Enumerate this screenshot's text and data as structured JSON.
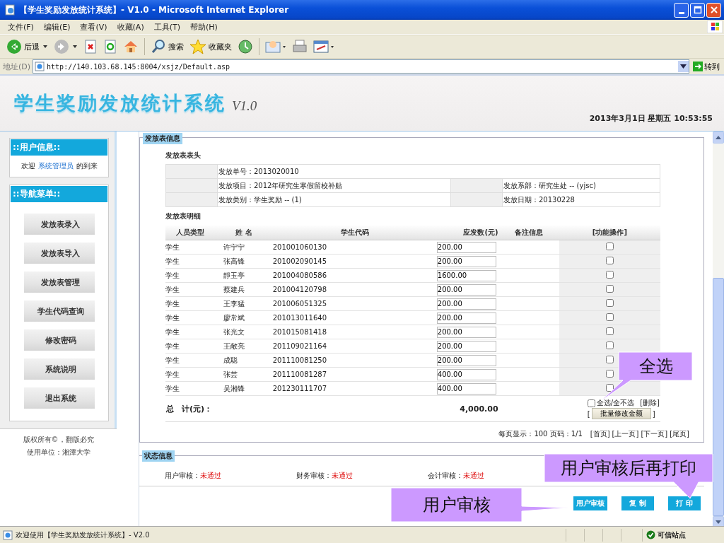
{
  "window": {
    "title": "【学生奖励发放统计系统】- V1.0 - Microsoft Internet Explorer"
  },
  "menu": [
    "文件(F)",
    "编辑(E)",
    "查看(V)",
    "收藏(A)",
    "工具(T)",
    "帮助(H)"
  ],
  "toolbar": [
    {
      "kind": "back",
      "label": "后退"
    },
    {
      "kind": "forward"
    },
    {
      "kind": "stop"
    },
    {
      "kind": "refresh"
    },
    {
      "kind": "home"
    },
    {
      "kind": "search",
      "label": "搜索"
    },
    {
      "kind": "favorites",
      "label": "收藏夹"
    },
    {
      "kind": "history"
    },
    {
      "kind": "mail"
    },
    {
      "kind": "print"
    },
    {
      "kind": "edit"
    }
  ],
  "address": {
    "label": "地址(D)",
    "url": "http://140.103.68.145:8004/xsjz/Default.asp",
    "go": "转到"
  },
  "header": {
    "logo": "学生奖励发放统计系统",
    "version": "V1.0",
    "datetime": "2013年3月1日 星期五 10:53:55"
  },
  "sidebar": {
    "user_title": "::用户信息::",
    "welcome_prefix": "欢迎",
    "user": "系统管理员",
    "welcome_suffix": "的到来",
    "nav_title": "::导航菜单::",
    "nav": [
      "发放表录入",
      "发放表导入",
      "发放表管理",
      "学生代码查询",
      "修改密码",
      "系统说明",
      "退出系统"
    ],
    "footer": [
      "版权所有©，翻版必究",
      "使用单位：湘潭大学"
    ]
  },
  "sheet": {
    "title": "发放表信息",
    "head_title": "发放表表头",
    "head_rows": [
      [
        {
          "label": "发放单号：",
          "value": "2013020010"
        }
      ],
      [
        {
          "label": "发放项目：",
          "value": "2012年研究生寒假留校补贴"
        },
        {
          "label": "发放系部：",
          "value": "研究生处 -- (yjsc)"
        }
      ],
      [
        {
          "label": "发放类别：",
          "value": "学生奖励 -- (1)"
        },
        {
          "label": "发放日期：",
          "value": "20130228"
        }
      ]
    ],
    "detail_title": "发放表明细",
    "columns": [
      "人员类型",
      "姓 名",
      "学生代码",
      "应发数(元)",
      "备注信息",
      "[功能操作]"
    ],
    "rows": [
      {
        "type": "学生",
        "name": "许宁宁",
        "code": "201001060130",
        "amount": "200.00",
        "checked": false
      },
      {
        "type": "学生",
        "name": "张高锋",
        "code": "201002090145",
        "amount": "200.00",
        "checked": false
      },
      {
        "type": "学生",
        "name": "靜玉亭",
        "code": "201004080586",
        "amount": "1600.00",
        "checked": false
      },
      {
        "type": "学生",
        "name": "蔡建兵",
        "code": "201004120798",
        "amount": "200.00",
        "checked": false
      },
      {
        "type": "学生",
        "name": "王李猛",
        "code": "201006051325",
        "amount": "200.00",
        "checked": false
      },
      {
        "type": "学生",
        "name": "廖常斌",
        "code": "201013011640",
        "amount": "200.00",
        "checked": false
      },
      {
        "type": "学生",
        "name": "张光文",
        "code": "201015081418",
        "amount": "200.00",
        "checked": false
      },
      {
        "type": "学生",
        "name": "王敞亮",
        "code": "201109021164",
        "amount": "200.00",
        "checked": false
      },
      {
        "type": "学生",
        "name": "成聪",
        "code": "201110081250",
        "amount": "200.00",
        "checked": false
      },
      {
        "type": "学生",
        "name": "张芸",
        "code": "201110081287",
        "amount": "400.00",
        "checked": false
      },
      {
        "type": "学生",
        "name": "吴湘锋",
        "code": "201230111707",
        "amount": "400.00",
        "checked": false
      }
    ],
    "total_label": "总　计(元)：",
    "total": "4,000.00",
    "select_all": {
      "label": "全选/全不选",
      "checked": false
    },
    "delete": "[删除]",
    "batch_open": "[",
    "batch": "批量修改金额",
    "batch_close": "]",
    "paging": "每页显示：100 页码：1/1",
    "page_links": [
      "[首页]",
      "[上一页]",
      "[下一页]",
      "[尾页]"
    ]
  },
  "status": {
    "title": "状态信息",
    "items": [
      {
        "label": "用户审核：",
        "value": "未通过"
      },
      {
        "label": "财务审核：",
        "value": "未通过"
      },
      {
        "label": "会计审核：",
        "value": "未通过"
      }
    ]
  },
  "buttons": [
    "用户审核",
    "复 制",
    "打 印"
  ],
  "callouts": [
    "全选",
    "用户审核后再打印",
    "用户审核"
  ],
  "status_bar": {
    "text": "欢迎使用【学生奖励发放统计系统】- V2.0",
    "zone": "可信站点"
  }
}
